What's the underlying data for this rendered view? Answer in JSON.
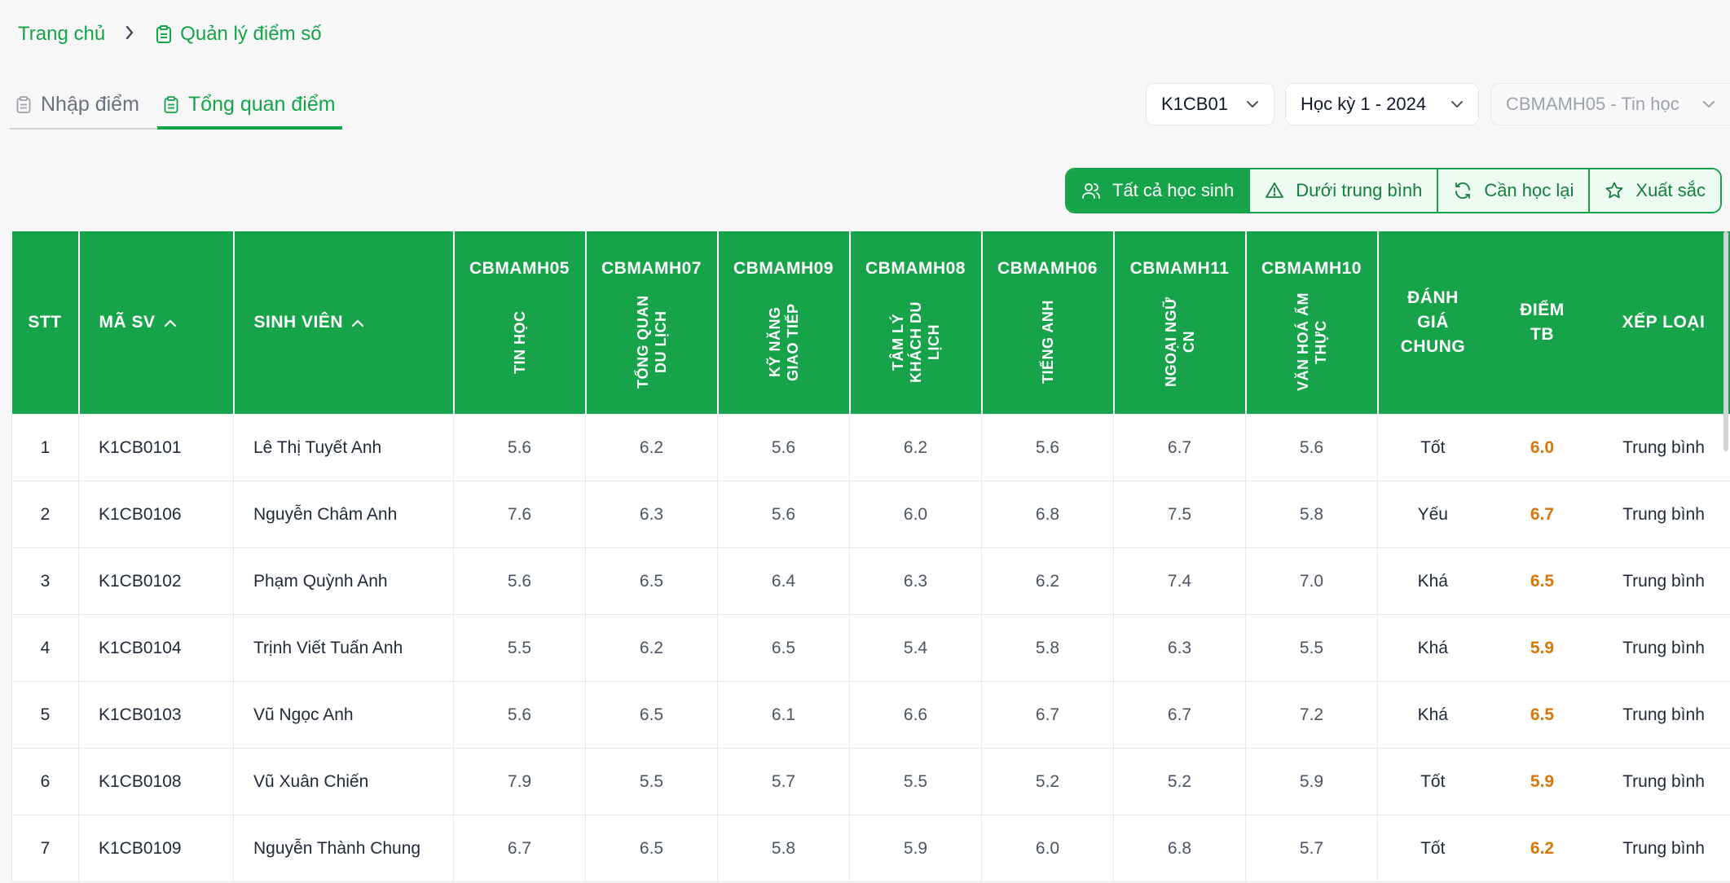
{
  "breadcrumb": {
    "home": "Trang chủ",
    "current": "Quản lý điểm số"
  },
  "tabs": [
    {
      "label": "Nhập điểm"
    },
    {
      "label": "Tổng quan điểm"
    }
  ],
  "selects": {
    "class": "K1CB01",
    "semester": "Học kỳ 1 - 2024",
    "subject": "CBMAMH05 - Tin học"
  },
  "filters": [
    {
      "label": "Tất cả học sinh"
    },
    {
      "label": "Dưới trung bình"
    },
    {
      "label": "Cần học lại"
    },
    {
      "label": "Xuất sắc"
    }
  ],
  "table": {
    "headers": {
      "stt": "STT",
      "ma_sv": "MÃ SV",
      "sinh_vien": "SINH VIÊN",
      "danh_gia_1": "ĐÁNH",
      "danh_gia_2": "GIÁ",
      "danh_gia_3": "CHUNG",
      "diem_1": "ĐIỂM",
      "diem_2": "TB",
      "xep_loai": "XẾP LOẠI"
    },
    "subjects": [
      {
        "code": "CBMAMH05",
        "name": "TIN HỌC"
      },
      {
        "code": "CBMAMH07",
        "name": "TỔNG QUAN DU LỊCH"
      },
      {
        "code": "CBMAMH09",
        "name": "KỸ NĂNG GIAO TIẾP"
      },
      {
        "code": "CBMAMH08",
        "name": "TÂM LÝ KHÁCH DU LỊCH"
      },
      {
        "code": "CBMAMH06",
        "name": "TIẾNG ANH"
      },
      {
        "code": "CBMAMH11",
        "name": "NGOẠI NGỮ CN"
      },
      {
        "code": "CBMAMH10",
        "name": "VĂN HOÁ ẨM THỰC"
      }
    ],
    "rows": [
      {
        "stt": "1",
        "ma_sv": "K1CB0101",
        "name": "Lê Thị Tuyết Anh",
        "scores": [
          "5.6",
          "6.2",
          "5.6",
          "6.2",
          "5.6",
          "6.7",
          "5.6"
        ],
        "danh_gia": "Tốt",
        "diem_tb": "6.0",
        "xep_loai": "Trung bình"
      },
      {
        "stt": "2",
        "ma_sv": "K1CB0106",
        "name": "Nguyễn Châm Anh",
        "scores": [
          "7.6",
          "6.3",
          "5.6",
          "6.0",
          "6.8",
          "7.5",
          "5.8"
        ],
        "danh_gia": "Yếu",
        "diem_tb": "6.7",
        "xep_loai": "Trung bình"
      },
      {
        "stt": "3",
        "ma_sv": "K1CB0102",
        "name": "Phạm Quỳnh Anh",
        "scores": [
          "5.6",
          "6.5",
          "6.4",
          "6.3",
          "6.2",
          "7.4",
          "7.0"
        ],
        "danh_gia": "Khá",
        "diem_tb": "6.5",
        "xep_loai": "Trung bình"
      },
      {
        "stt": "4",
        "ma_sv": "K1CB0104",
        "name": "Trịnh Viết Tuấn Anh",
        "scores": [
          "5.5",
          "6.2",
          "6.5",
          "5.4",
          "5.8",
          "6.3",
          "5.5"
        ],
        "danh_gia": "Khá",
        "diem_tb": "5.9",
        "xep_loai": "Trung bình"
      },
      {
        "stt": "5",
        "ma_sv": "K1CB0103",
        "name": "Vũ Ngọc Anh",
        "scores": [
          "5.6",
          "6.5",
          "6.1",
          "6.6",
          "6.7",
          "6.7",
          "7.2"
        ],
        "danh_gia": "Khá",
        "diem_tb": "6.5",
        "xep_loai": "Trung bình"
      },
      {
        "stt": "6",
        "ma_sv": "K1CB0108",
        "name": "Vũ Xuân Chiến",
        "scores": [
          "7.9",
          "5.5",
          "5.7",
          "5.5",
          "5.2",
          "5.2",
          "5.9"
        ],
        "danh_gia": "Tốt",
        "diem_tb": "5.9",
        "xep_loai": "Trung bình"
      },
      {
        "stt": "7",
        "ma_sv": "K1CB0109",
        "name": "Nguyễn Thành Chung",
        "scores": [
          "6.7",
          "6.5",
          "5.8",
          "5.9",
          "6.0",
          "6.8",
          "5.7"
        ],
        "danh_gia": "Tốt",
        "diem_tb": "6.2",
        "xep_loai": "Trung bình"
      }
    ]
  },
  "colors": {
    "primary": "#16a34a",
    "avg_score": "#d97706"
  }
}
